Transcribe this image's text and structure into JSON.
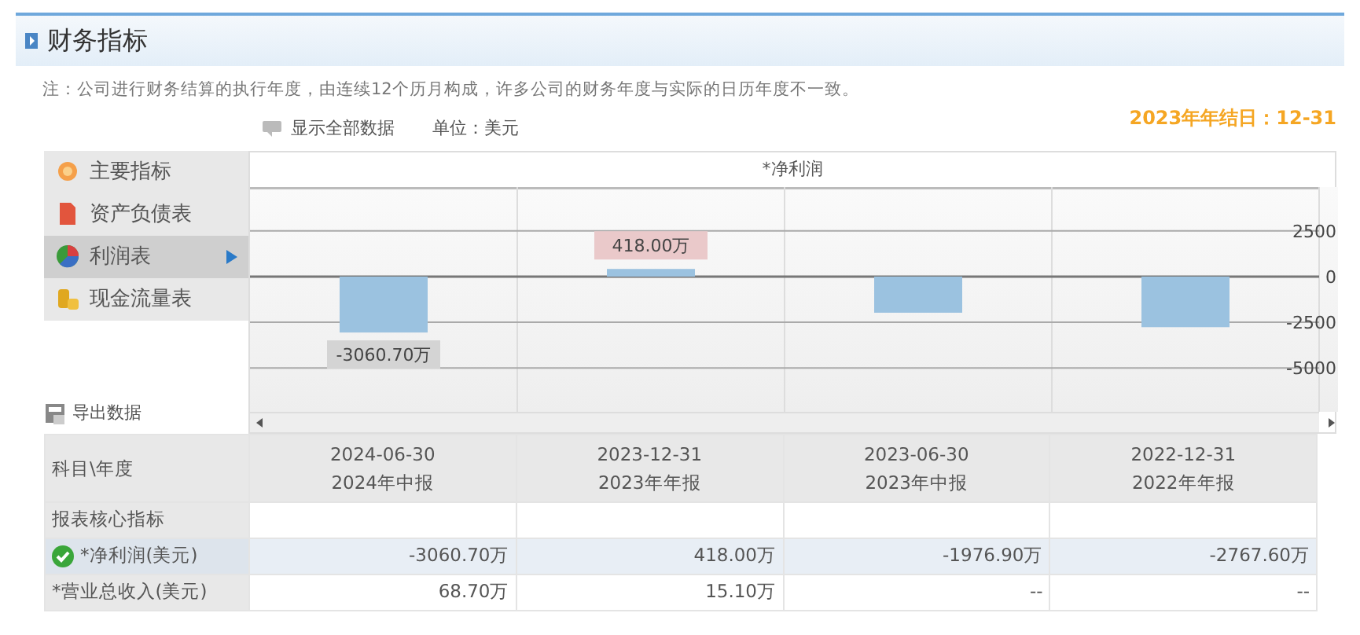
{
  "header": {
    "title": "财务指标"
  },
  "note": "注：公司进行财务结算的执行年度，由连续12个历月构成，许多公司的财务年度与实际的日历年度不一致。",
  "toolbar": {
    "show_all": "显示全部数据",
    "unit": "单位：美元",
    "fiscal_year_end": "2023年年结日：12-31"
  },
  "sidebar": {
    "items": [
      {
        "label": "主要指标",
        "selected": false
      },
      {
        "label": "资产负债表",
        "selected": false
      },
      {
        "label": "利润表",
        "selected": true
      },
      {
        "label": "现金流量表",
        "selected": false
      }
    ],
    "export": "导出数据"
  },
  "chart": {
    "chart_data": {
      "type": "bar",
      "title": "*净利润",
      "grid": true,
      "values": [
        -3060.7,
        418.0,
        -1976.9,
        -2767.6
      ],
      "ylim": [
        -7400,
        4900
      ],
      "yticks": [
        -5000,
        -2500,
        0,
        2500
      ],
      "value_labels": [
        "-3060.70万",
        "418.00万",
        null,
        null
      ]
    }
  },
  "table": {
    "columns": [
      {
        "label": "科目\\年度"
      },
      {
        "date": "2024-06-30",
        "period": "2024年中报"
      },
      {
        "date": "2023-12-31",
        "period": "2023年年报"
      },
      {
        "date": "2023-06-30",
        "period": "2023年中报"
      },
      {
        "date": "2022-12-31",
        "period": "2022年年报"
      }
    ],
    "rows": [
      {
        "label": "报表核心指标",
        "selected": false
      },
      {
        "label": "*净利润(美元)",
        "selected": true,
        "cells": [
          "-3060.70万",
          "418.00万",
          "-1976.90万",
          "-2767.60万"
        ]
      },
      {
        "label": "*营业总收入(美元)",
        "selected": false,
        "cells": [
          "68.70万",
          "15.10万",
          "--",
          "--"
        ]
      }
    ]
  }
}
